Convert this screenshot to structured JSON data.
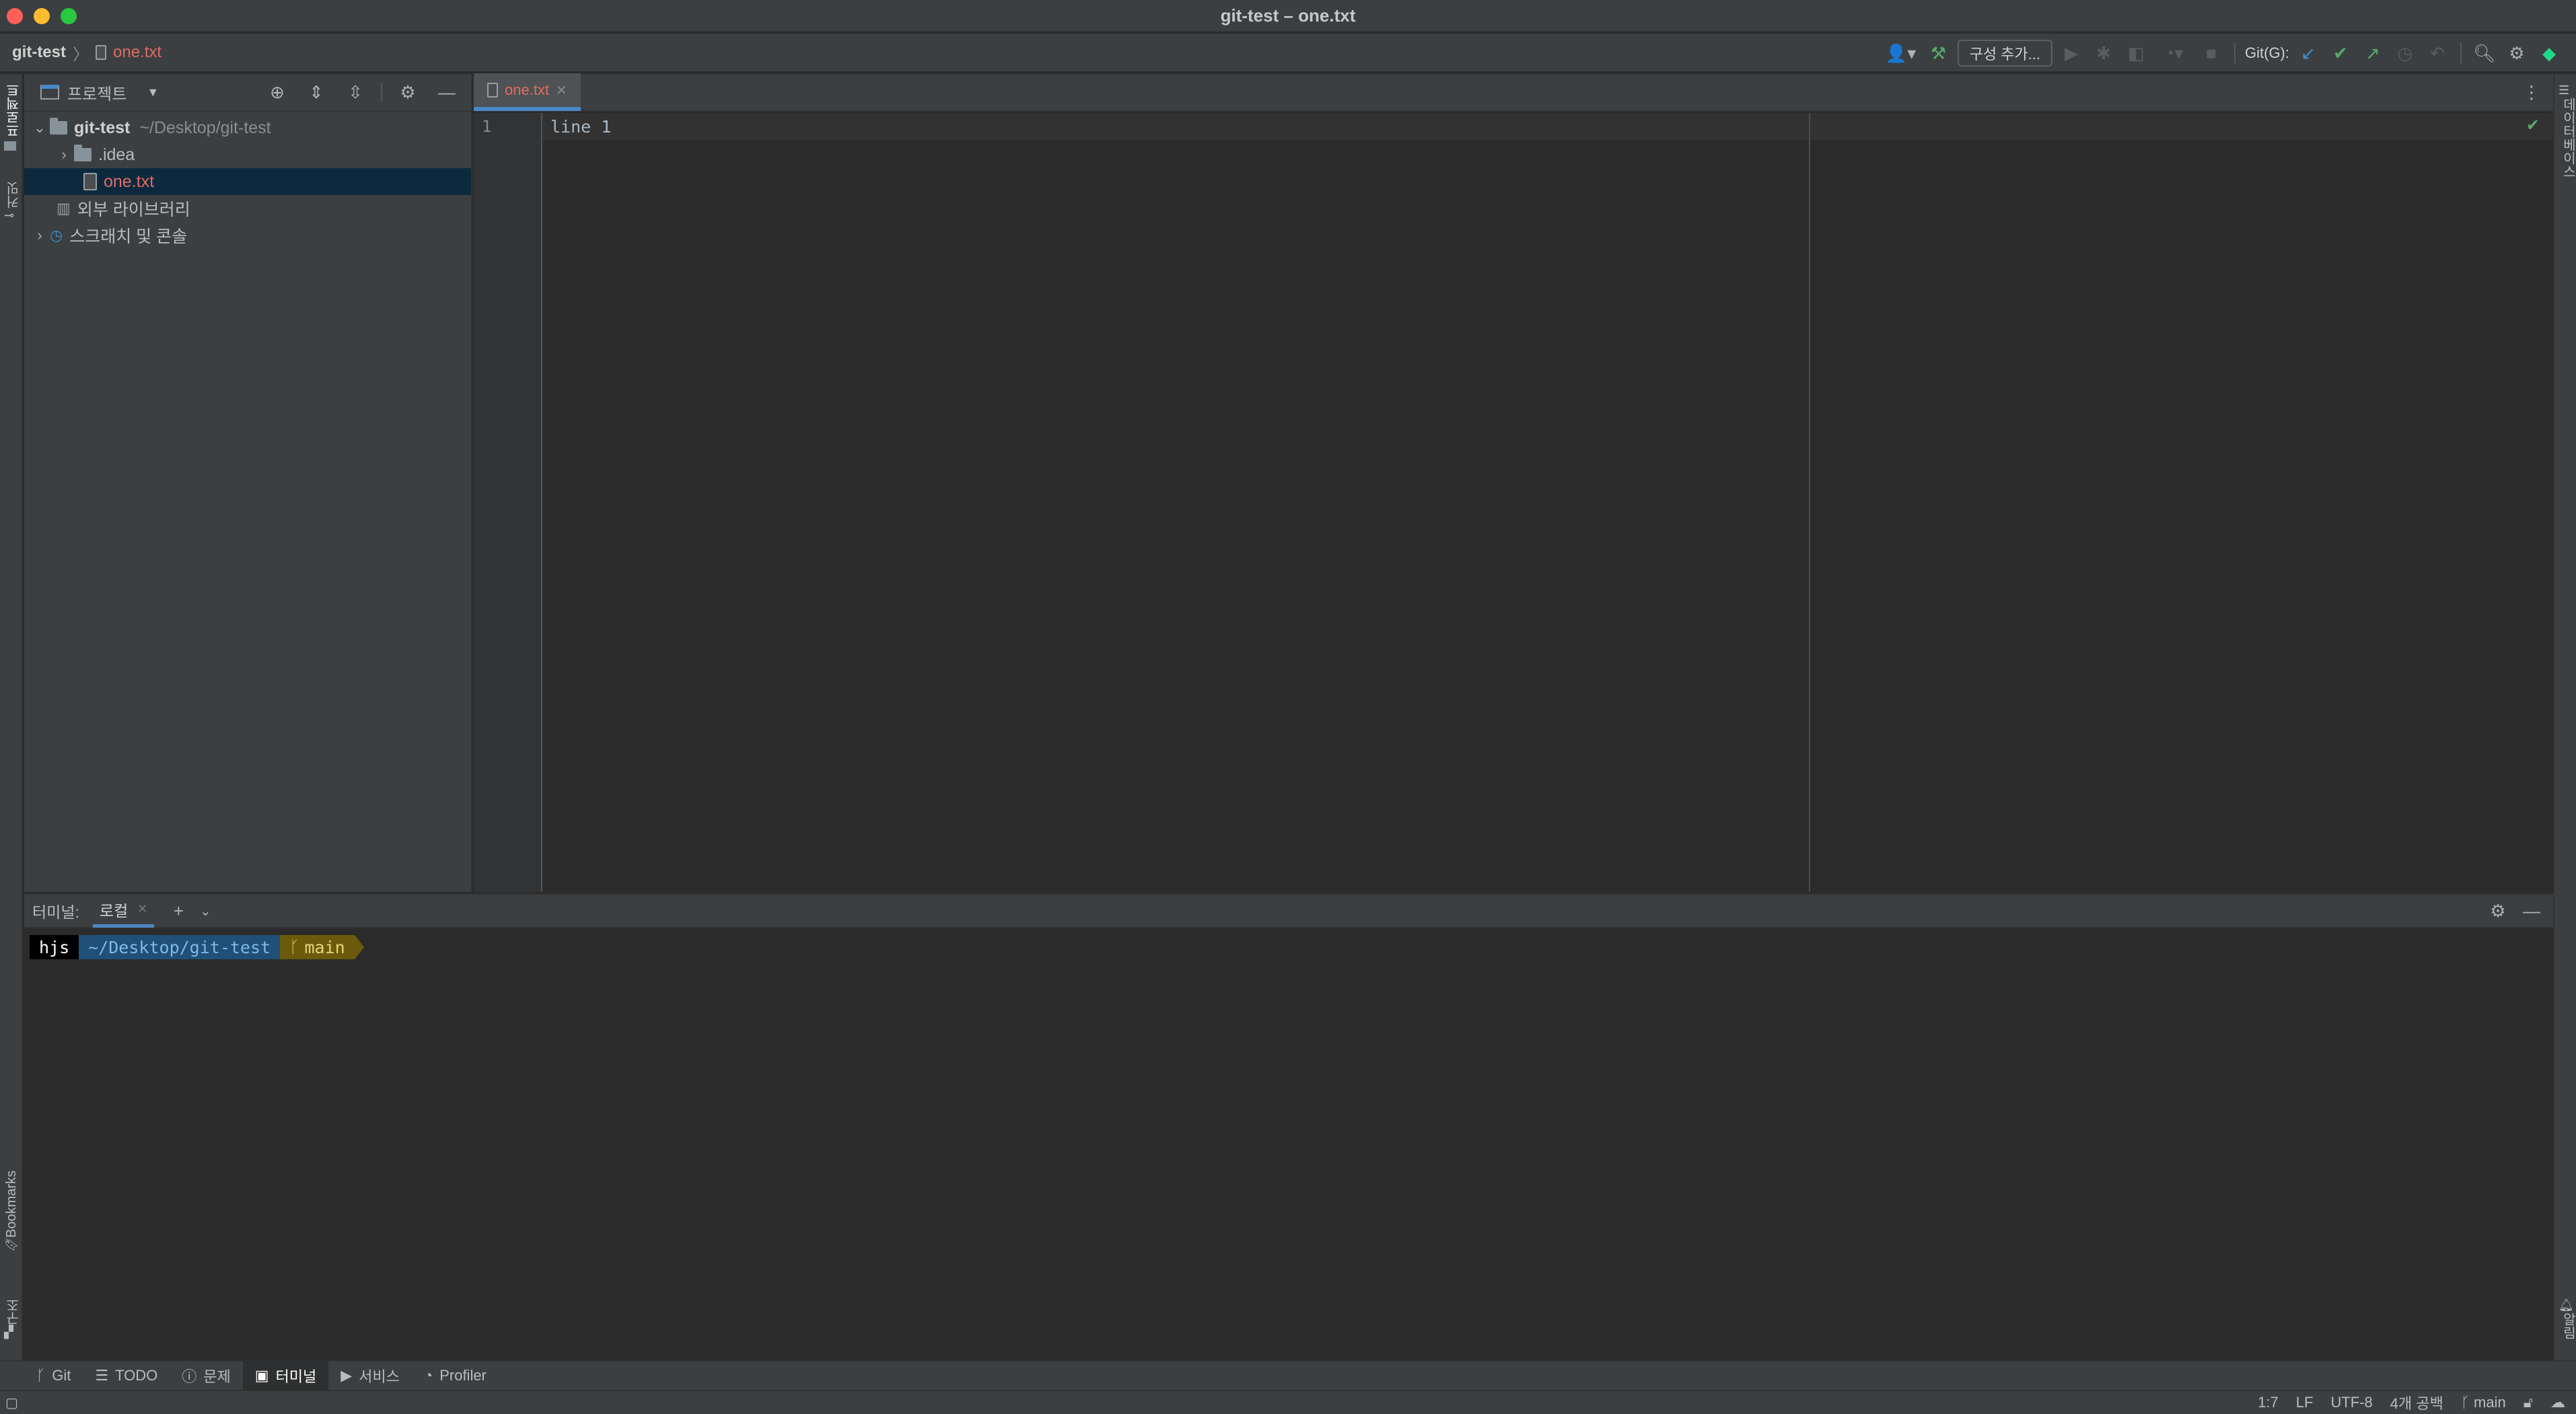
{
  "window": {
    "title": "git-test – one.txt"
  },
  "navbar": {
    "project": "git-test",
    "file": "one.txt",
    "run_config": "구성 추가...",
    "git_label": "Git(G):"
  },
  "left_stripe": {
    "project_tab": "프로젝트",
    "commit_tab": "커밋",
    "bookmarks_tab": "Bookmarks",
    "structure_tab": "구조"
  },
  "right_stripe": {
    "database_tab": "데이터베이스",
    "notifications_tab": "알림"
  },
  "project_panel": {
    "title": "프로젝트",
    "tree": [
      {
        "name": "git-test",
        "path": "~/Desktop/git-test"
      },
      {
        "name": ".idea"
      },
      {
        "name": "one.txt"
      },
      {
        "name": "외부 라이브러리"
      },
      {
        "name": "스크래치 및 콘솔"
      }
    ]
  },
  "editor": {
    "tab": "one.txt",
    "lines": [
      {
        "number": "1",
        "text": "line 1"
      }
    ]
  },
  "terminal": {
    "label": "터미널:",
    "tab": "로컬",
    "prompt": {
      "user": "hjs",
      "path": "~/Desktop/git-test",
      "branch": "main"
    }
  },
  "bottom_tools": [
    "Git",
    "TODO",
    "문제",
    "터미널",
    "서비스",
    "Profiler"
  ],
  "status": {
    "position": "1:7",
    "line_sep": "LF",
    "encoding": "UTF-8",
    "indent": "4개 공백",
    "branch": "main"
  }
}
